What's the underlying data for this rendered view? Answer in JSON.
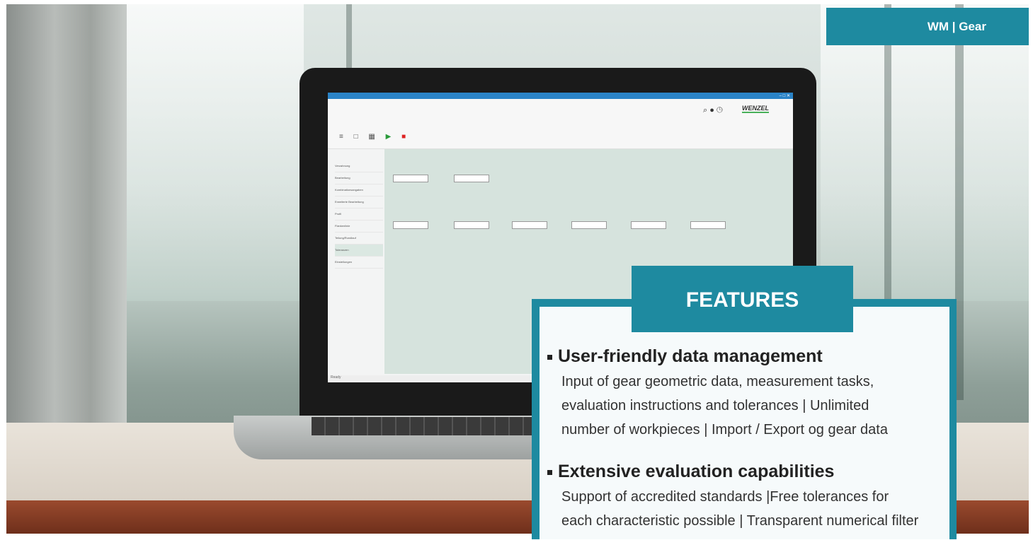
{
  "brand": {
    "label": "WM | Gear"
  },
  "features": {
    "title": "FEATURES",
    "items": [
      {
        "heading": "User-friendly data management",
        "lines": [
          "Input of gear geometric data, measurement tasks,",
          "evaluation instructions and tolerances  | Unlimited",
          "number of workpieces | Import / Export og gear data"
        ]
      },
      {
        "heading": "Extensive evaluation capabilities",
        "lines": [
          "Support of accredited standards |Free tolerances for",
          "each characteristic possible | Transparent numerical filter"
        ]
      }
    ]
  },
  "app": {
    "logo": "WENZEL",
    "top_icons": "⌕ ● ◷",
    "toolbar_icons": "≡ □ ▦",
    "play": "▶",
    "stop": "■",
    "sidebar": [
      "Verzahnung",
      "Bearbeitung",
      "Kombinationsangaben",
      "Erweiterte Bearbeitung",
      "Profil",
      "Flankenlinie",
      "Teilung/Rundlauf",
      "Toleranzen",
      "Einstellungen"
    ],
    "status": "Ready"
  },
  "colors": {
    "accent": "#1e8aa0"
  }
}
